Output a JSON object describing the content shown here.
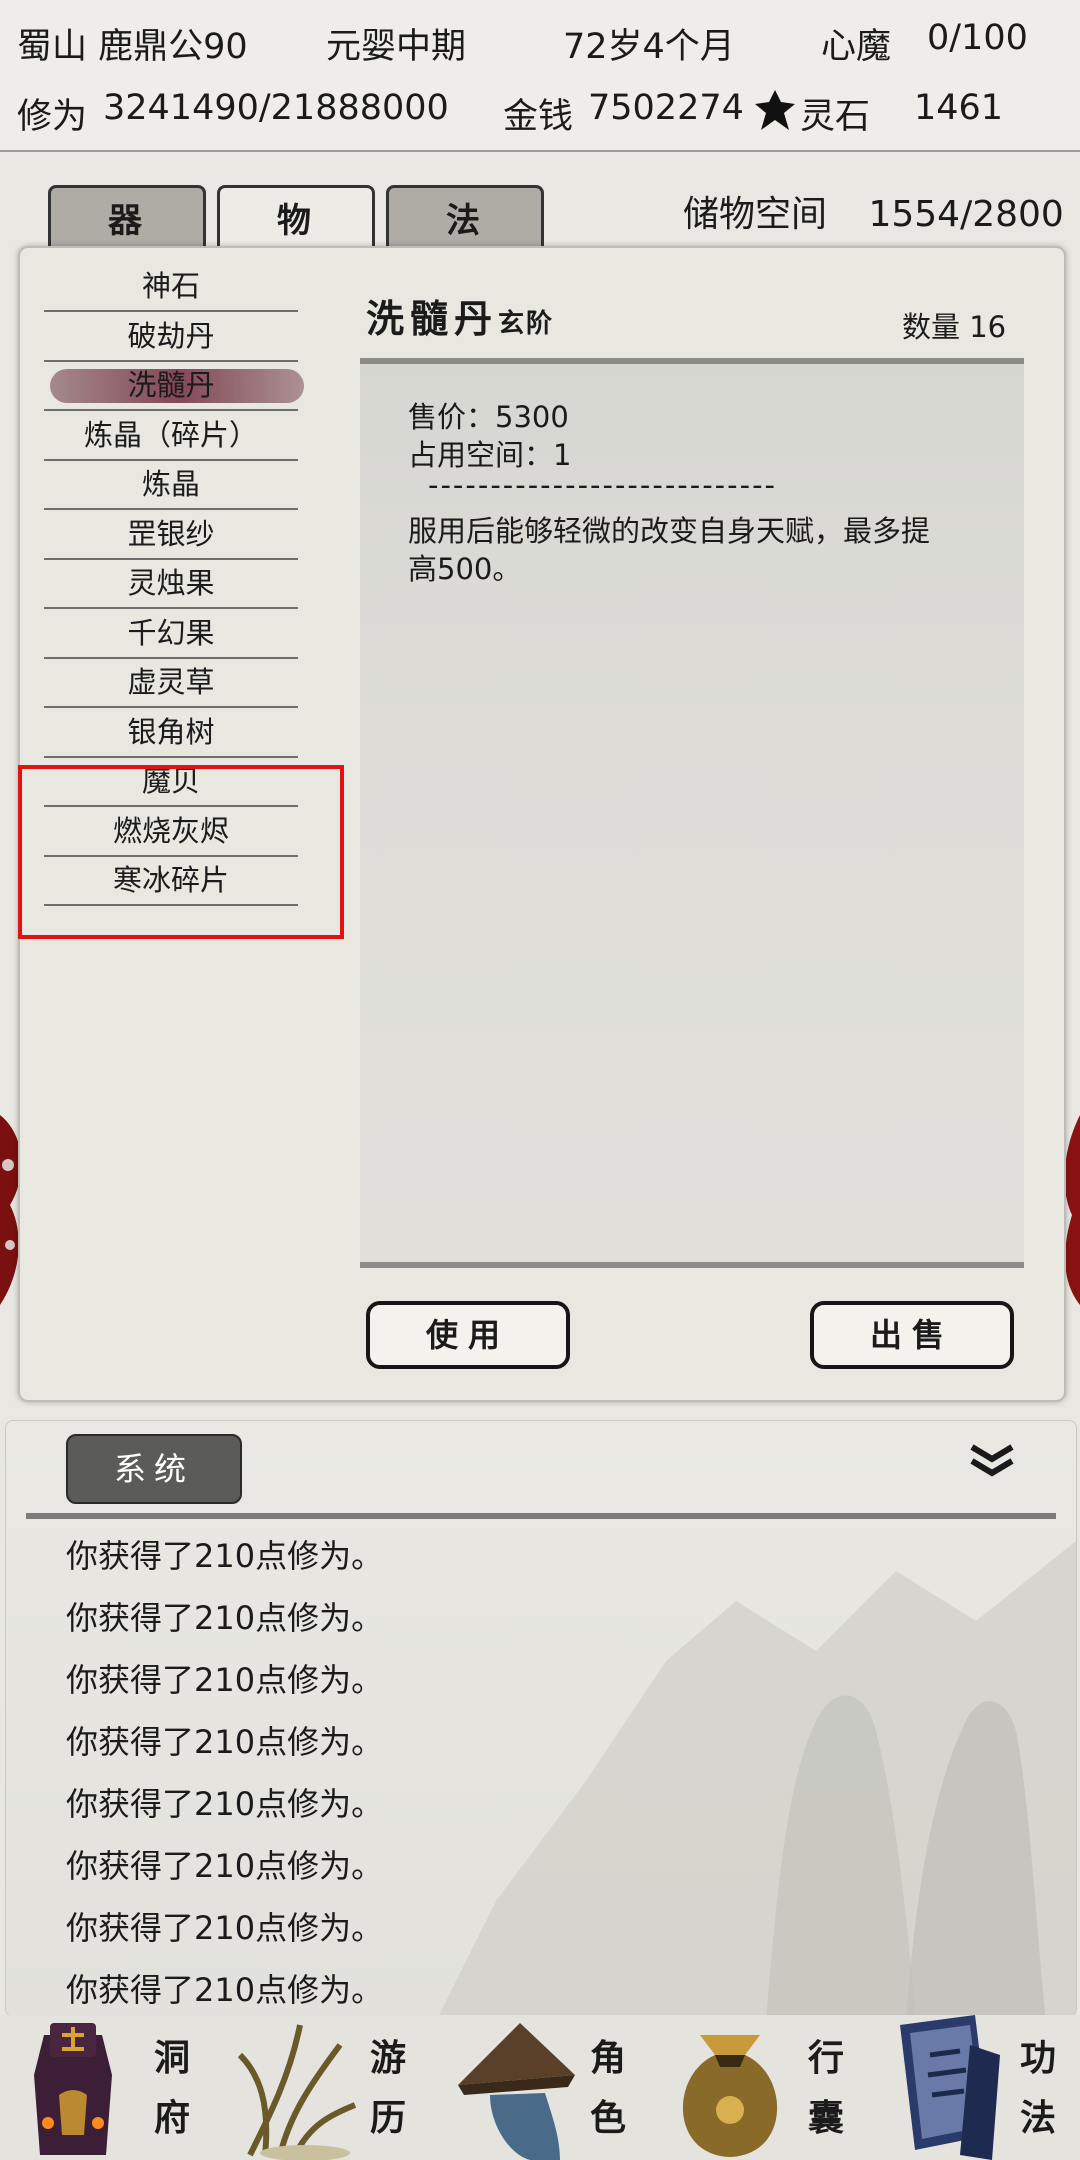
{
  "header": {
    "character": "蜀山 鹿鼎公90",
    "realm": "元婴中期",
    "age": "72岁4个月",
    "demon_label": "心魔",
    "demon_value": "0/100",
    "cultivation_label": "修为",
    "cultivation_value": "3241490/21888000",
    "money_label": "金钱",
    "money_value": "7502274",
    "stone_label": "灵石",
    "stone_value": "1461"
  },
  "tabs": [
    {
      "label": "器",
      "active": false
    },
    {
      "label": "物",
      "active": true
    },
    {
      "label": "法",
      "active": false
    }
  ],
  "storage": {
    "label": "储物空间",
    "value": "1554/2800"
  },
  "items": [
    {
      "label": "神石"
    },
    {
      "label": "破劫丹"
    },
    {
      "label": "洗髓丹",
      "selected": true
    },
    {
      "label": "炼晶（碎片）"
    },
    {
      "label": "炼晶"
    },
    {
      "label": "罡银纱"
    },
    {
      "label": "灵烛果"
    },
    {
      "label": "千幻果"
    },
    {
      "label": "虚灵草"
    },
    {
      "label": "银角树"
    },
    {
      "label": "魔贝"
    },
    {
      "label": "燃烧灰烬"
    },
    {
      "label": "寒冰碎片"
    }
  ],
  "detail": {
    "name": "洗髓丹",
    "grade": "玄阶",
    "quantity": "数量 16",
    "price": "售价：5300",
    "space": "占用空间：1",
    "divider": "----------------------------",
    "desc_line1": "服用后能够轻微的改变自身天赋，最多提",
    "desc_line2": "高500。"
  },
  "buttons": {
    "use": "使用",
    "sell": "出售"
  },
  "log": {
    "tab": "系统",
    "lines": [
      "你获得了210点修为。",
      "你获得了210点修为。",
      "你获得了210点修为。",
      "你获得了210点修为。",
      "你获得了210点修为。",
      "你获得了210点修为。",
      "你获得了210点修为。",
      "你获得了210点修为。"
    ]
  },
  "nav": [
    {
      "c1": "洞",
      "c2": "府",
      "icon": "cave-mansion-icon"
    },
    {
      "c1": "游",
      "c2": "历",
      "icon": "travel-icon"
    },
    {
      "c1": "角",
      "c2": "色",
      "icon": "character-icon"
    },
    {
      "c1": "行",
      "c2": "囊",
      "icon": "bag-icon"
    },
    {
      "c1": "功",
      "c2": "法",
      "icon": "technique-icon"
    }
  ],
  "colors": {
    "highlight": "#e01212",
    "selected": "#7a3c48"
  }
}
